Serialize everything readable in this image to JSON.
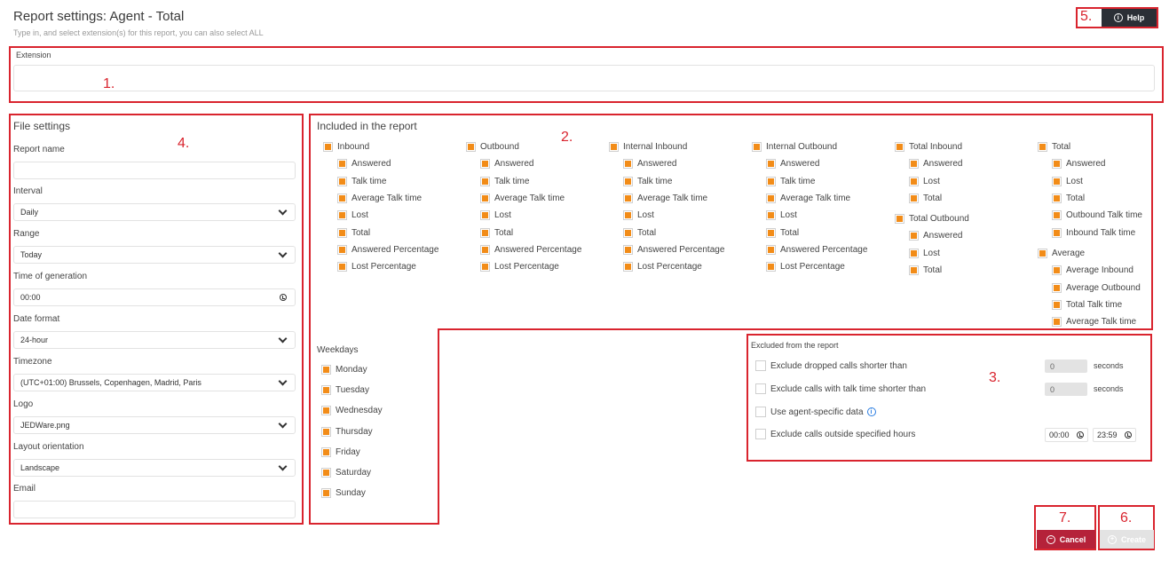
{
  "header": {
    "title": "Report settings: Agent - Total",
    "subtitle": "Type in, and select extension(s) for this report, you can also select ALL",
    "help_label": "Help"
  },
  "annotations": [
    "1.",
    "2.",
    "3.",
    "4.",
    "5.",
    "6.",
    "7."
  ],
  "extension": {
    "label": "Extension",
    "value": ""
  },
  "file_settings": {
    "title": "File settings",
    "report_name_label": "Report name",
    "report_name_value": "",
    "interval_label": "Interval",
    "interval_value": "Daily",
    "range_label": "Range",
    "range_value": "Today",
    "time_label": "Time of generation",
    "time_value": "00:00",
    "date_format_label": "Date format",
    "date_format_value": "24-hour",
    "timezone_label": "Timezone",
    "timezone_value": "(UTC+01:00) Brussels, Copenhagen, Madrid, Paris",
    "logo_label": "Logo",
    "logo_value": "JEDWare.png",
    "orientation_label": "Layout orientation",
    "orientation_value": "Landscape",
    "email_label": "Email",
    "email_value": ""
  },
  "included": {
    "title": "Included in the report",
    "groups": {
      "inbound": {
        "label": "Inbound",
        "items": [
          "Answered",
          "Talk time",
          "Average Talk time",
          "Lost",
          "Total",
          "Answered Percentage",
          "Lost Percentage"
        ]
      },
      "outbound": {
        "label": "Outbound",
        "items": [
          "Answered",
          "Talk time",
          "Average Talk time",
          "Lost",
          "Total",
          "Answered Percentage",
          "Lost Percentage"
        ]
      },
      "internal_inbound": {
        "label": "Internal Inbound",
        "items": [
          "Answered",
          "Talk time",
          "Average Talk time",
          "Lost",
          "Total",
          "Answered Percentage",
          "Lost Percentage"
        ]
      },
      "internal_outbound": {
        "label": "Internal Outbound",
        "items": [
          "Answered",
          "Talk time",
          "Average Talk time",
          "Lost",
          "Total",
          "Answered Percentage",
          "Lost Percentage"
        ]
      },
      "total_inbound": {
        "label": "Total Inbound",
        "items": [
          "Answered",
          "Lost",
          "Total"
        ]
      },
      "total_outbound": {
        "label": "Total Outbound",
        "items": [
          "Answered",
          "Lost",
          "Total"
        ]
      },
      "total": {
        "label": "Total",
        "items": [
          "Answered",
          "Lost",
          "Total",
          "Outbound Talk time",
          "Inbound Talk time"
        ]
      },
      "average": {
        "label": "Average",
        "items": [
          "Average Inbound",
          "Average Outbound",
          "Total Talk time",
          "Average Talk time"
        ]
      }
    }
  },
  "weekdays": {
    "title": "Weekdays",
    "items": [
      "Monday",
      "Tuesday",
      "Wednesday",
      "Thursday",
      "Friday",
      "Saturday",
      "Sunday"
    ]
  },
  "excluded": {
    "title": "Excluded from the report",
    "dropped_label": "Exclude dropped calls shorter than",
    "dropped_value": "0",
    "talk_label": "Exclude calls with talk time shorter than",
    "talk_value": "0",
    "seconds": "seconds",
    "agent_label": "Use agent-specific data",
    "hours_label": "Exclude calls outside specified hours",
    "hours_from": "00:00",
    "hours_to": "23:59"
  },
  "footer": {
    "cancel_label": "Cancel",
    "create_label": "Create"
  },
  "colors": {
    "accent": "#f28c18",
    "annotation": "#d9242e",
    "cancel": "#b5223a",
    "help": "#2b2f36"
  }
}
